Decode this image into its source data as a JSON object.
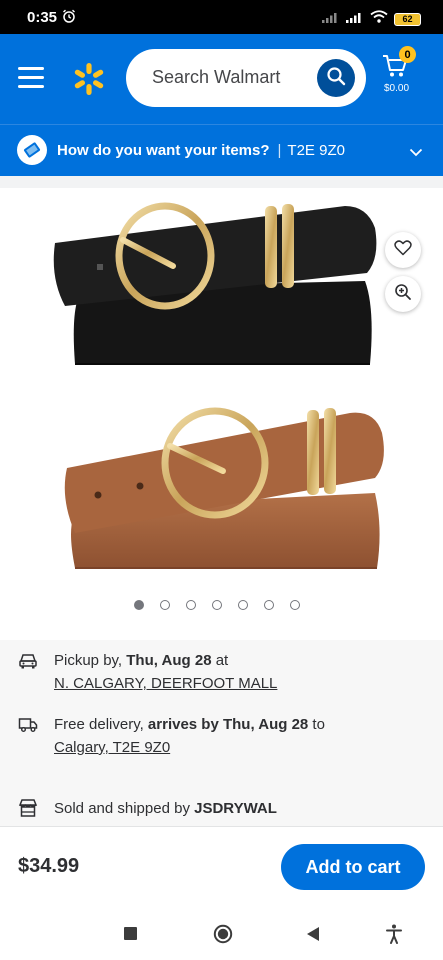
{
  "status_bar": {
    "time": "0:35",
    "battery": "62"
  },
  "header": {
    "search_placeholder": "Search Walmart",
    "cart_count": "0",
    "cart_total": "$0.00"
  },
  "fulfillment": {
    "prompt": "How do you want your items?",
    "separator": "|",
    "postal_code": "T2E 9Z0"
  },
  "gallery": {
    "image_count": 7,
    "active_index": 0
  },
  "pickup": {
    "prefix": "Pickup by, ",
    "date": "Thu, Aug 28",
    "suffix": " at",
    "store": "N. CALGARY, DEERFOOT MALL"
  },
  "delivery": {
    "prefix": "Free delivery, ",
    "emphasis": "arrives by Thu, Aug 28",
    "suffix": " to",
    "location": "Calgary, T2E 9Z0"
  },
  "seller": {
    "prefix": "Sold and shipped by ",
    "name": "JSDRYWAL"
  },
  "footer": {
    "price": "$34.99",
    "add_to_cart": "Add to cart"
  },
  "colors": {
    "brand_blue": "#0071dc",
    "spark_yellow": "#ffc220",
    "dark_blue": "#004f9a"
  }
}
